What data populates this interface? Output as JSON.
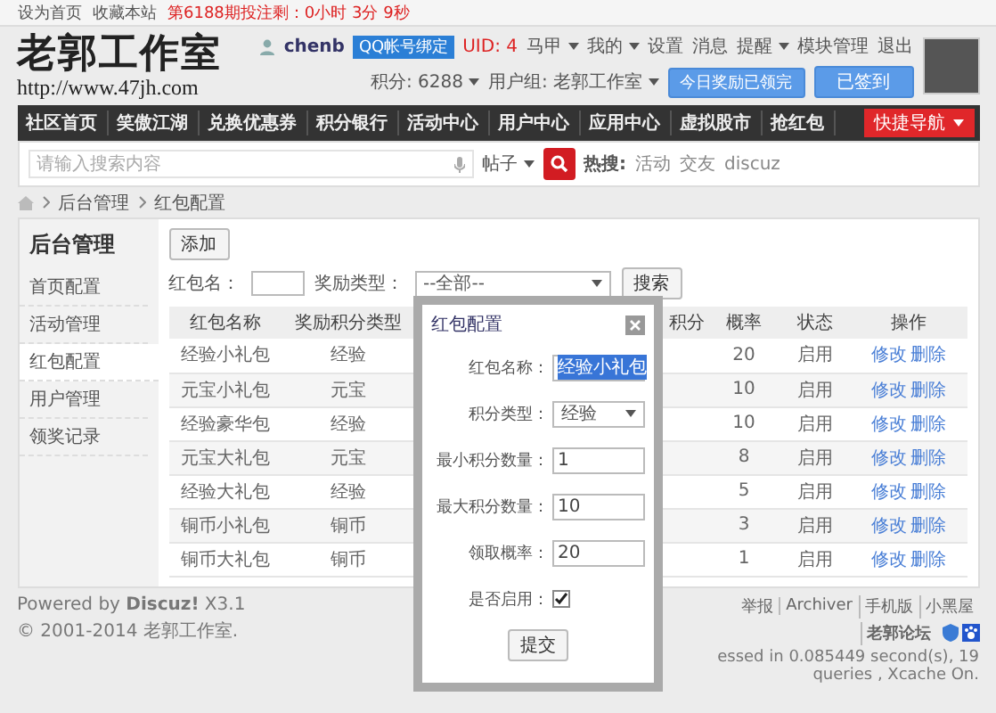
{
  "topbar": {
    "links": [
      "设为首页",
      "收藏本站"
    ],
    "notice": "第6188期投注剩：0小时 3分 9秒"
  },
  "header": {
    "logo": "老郭工作室",
    "url": "http://www.47jh.com",
    "user": {
      "name": "chenb",
      "qq_badge": "QQ帐号绑定",
      "uid": "UID: 4",
      "menu": [
        {
          "label": "马甲",
          "dropdown": true
        },
        {
          "label": "我的",
          "dropdown": true
        },
        {
          "label": "设置",
          "dropdown": false
        },
        {
          "label": "消息",
          "dropdown": false
        },
        {
          "label": "提醒",
          "dropdown": true
        },
        {
          "label": "模块管理",
          "dropdown": false
        },
        {
          "label": "退出",
          "dropdown": false
        }
      ],
      "points": "积分: 6288",
      "group": "用户组: 老郭工作室",
      "reward_button": "今日奖励已领完",
      "sign_button": "已签到"
    }
  },
  "nav": {
    "items": [
      "社区首页",
      "笑傲江湖",
      "兑换优惠券",
      "积分银行",
      "活动中心",
      "用户中心",
      "应用中心",
      "虚拟股市",
      "抢红包"
    ],
    "quick": "快捷导航"
  },
  "search": {
    "placeholder": "请输入搜索内容",
    "scope": "帖子",
    "hot_label": "热搜:",
    "hot": [
      "活动",
      "交友",
      "discuz"
    ]
  },
  "breadcrumb": [
    "后台管理",
    "红包配置"
  ],
  "sidebar": {
    "title": "后台管理",
    "items": [
      {
        "label": "首页配置",
        "selected": false
      },
      {
        "label": "活动管理",
        "selected": false
      },
      {
        "label": "红包配置",
        "selected": true
      },
      {
        "label": "用户管理",
        "selected": false
      },
      {
        "label": "领奖记录",
        "selected": false
      }
    ]
  },
  "toolbar": {
    "add": "添加",
    "name_label": "红包名：",
    "type_label": "奖励类型：",
    "type_value": "--全部--",
    "search": "搜索"
  },
  "table": {
    "columns": [
      "红包名称",
      "奖励积分类型",
      "",
      "积分",
      "概率",
      "状态",
      "操作"
    ],
    "rows": [
      {
        "name": "经验小礼包",
        "type": "经验",
        "prob": "20",
        "status": "启用",
        "actions": [
          "修改",
          "删除"
        ]
      },
      {
        "name": "元宝小礼包",
        "type": "元宝",
        "prob": "10",
        "status": "启用",
        "actions": [
          "修改",
          "删除"
        ]
      },
      {
        "name": "经验豪华包",
        "type": "经验",
        "prob": "10",
        "status": "启用",
        "actions": [
          "修改",
          "删除"
        ]
      },
      {
        "name": "元宝大礼包",
        "type": "元宝",
        "prob": "8",
        "status": "启用",
        "actions": [
          "修改",
          "删除"
        ]
      },
      {
        "name": "经验大礼包",
        "type": "经验",
        "prob": "5",
        "status": "启用",
        "actions": [
          "修改",
          "删除"
        ]
      },
      {
        "name": "铜币小礼包",
        "type": "铜币",
        "prob": "3",
        "status": "启用",
        "actions": [
          "修改",
          "删除"
        ]
      },
      {
        "name": "铜币大礼包",
        "type": "铜币",
        "prob": "1",
        "status": "启用",
        "actions": [
          "修改",
          "删除"
        ]
      }
    ]
  },
  "footer": {
    "powered": "Powered by **Discuz!** X3.1",
    "copyright": "© 2001-2014 老郭工作室.",
    "links": [
      "举报",
      "Archiver",
      "手机版",
      "小黑屋",
      "老郭论坛"
    ],
    "stats": "essed in 0.085449 second(s), 19 queries , Xcache On."
  },
  "dialog": {
    "title": "红包配置",
    "fields": [
      {
        "kind": "text",
        "label": "红包名称：",
        "value": "经验小礼包",
        "highlighted": true
      },
      {
        "kind": "select",
        "label": "积分类型：",
        "value": "经验"
      },
      {
        "kind": "text",
        "label": "最小积分数量：",
        "value": "1",
        "highlighted": false
      },
      {
        "kind": "text",
        "label": "最大积分数量：",
        "value": "10",
        "highlighted": false
      },
      {
        "kind": "text",
        "label": "领取概率：",
        "value": "20",
        "highlighted": false
      },
      {
        "kind": "checkbox",
        "label": "是否启用：",
        "checked": true
      }
    ],
    "submit": "提交"
  }
}
